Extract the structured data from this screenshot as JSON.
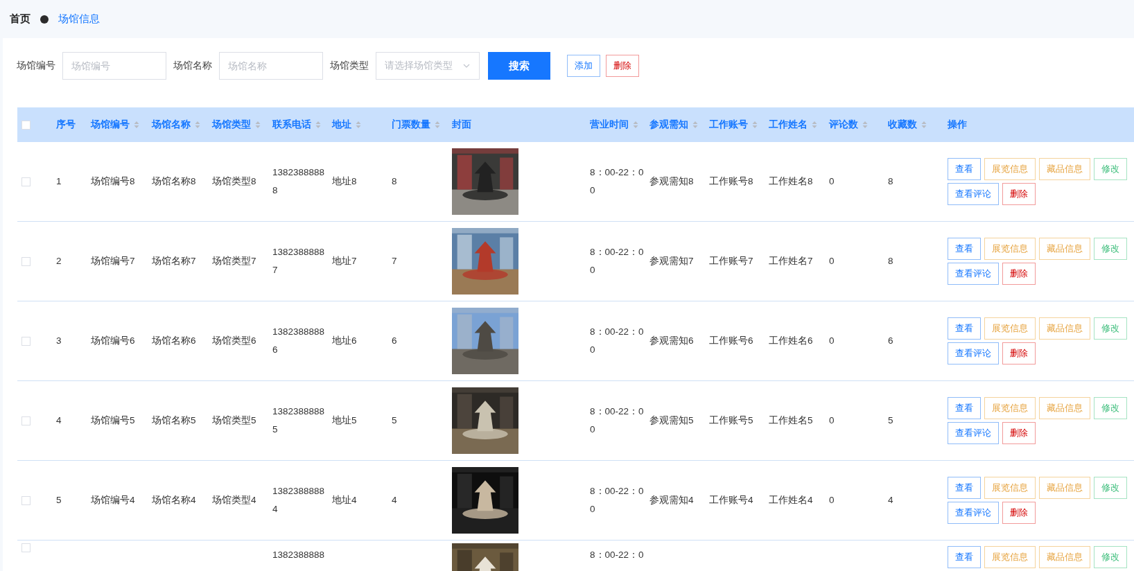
{
  "breadcrumb": {
    "home": "首页",
    "current": "场馆信息"
  },
  "search": {
    "fields": [
      {
        "label": "场馆编号",
        "kind": "input",
        "placeholder": "场馆编号"
      },
      {
        "label": "场馆名称",
        "kind": "input",
        "placeholder": "场馆名称"
      },
      {
        "label": "场馆类型",
        "kind": "select",
        "placeholder": "请选择场馆类型"
      }
    ],
    "search_button": "搜索",
    "add_button": "添加",
    "delete_button": "删除"
  },
  "table": {
    "header_checked": false,
    "columns": [
      {
        "label": "序号",
        "sortable": false
      },
      {
        "label": "场馆编号",
        "sortable": true
      },
      {
        "label": "场馆名称",
        "sortable": true
      },
      {
        "label": "场馆类型",
        "sortable": true
      },
      {
        "label": "联系电话",
        "sortable": true
      },
      {
        "label": "地址",
        "sortable": true
      },
      {
        "label": "门票数量",
        "sortable": true
      },
      {
        "label": "封面",
        "sortable": false
      },
      {
        "label": "营业时间",
        "sortable": true
      },
      {
        "label": "参观需知",
        "sortable": true
      },
      {
        "label": "工作账号",
        "sortable": true
      },
      {
        "label": "工作姓名",
        "sortable": true
      },
      {
        "label": "评论数",
        "sortable": true
      },
      {
        "label": "收藏数",
        "sortable": true
      },
      {
        "label": "操作",
        "sortable": false
      }
    ],
    "rows": [
      {
        "checked": false,
        "index": "1",
        "code": "场馆编号8",
        "name": "场馆名称8",
        "type": "场馆类型8",
        "phone": "13823888888",
        "address": "地址8",
        "tickets": "8",
        "hours": "8：00-22：00",
        "notice": "参观需知8",
        "account": "工作账号8",
        "staff": "工作姓名8",
        "comments": "0",
        "favorites": "8",
        "actions": [
          {
            "label": "查看",
            "kind": "primary"
          },
          {
            "label": "展览信息",
            "kind": "warning"
          },
          {
            "label": "藏品信息",
            "kind": "warning"
          },
          {
            "label": "修改",
            "kind": "success"
          },
          {
            "label": "查看评论",
            "kind": "primary"
          },
          {
            "label": "删除",
            "kind": "danger"
          }
        ]
      },
      {
        "checked": false,
        "index": "2",
        "code": "场馆编号7",
        "name": "场馆名称7",
        "type": "场馆类型7",
        "phone": "13823888887",
        "address": "地址7",
        "tickets": "7",
        "hours": "8：00-22：00",
        "notice": "参观需知7",
        "account": "工作账号7",
        "staff": "工作姓名7",
        "comments": "0",
        "favorites": "8",
        "actions": [
          {
            "label": "查看",
            "kind": "primary"
          },
          {
            "label": "展览信息",
            "kind": "warning"
          },
          {
            "label": "藏品信息",
            "kind": "warning"
          },
          {
            "label": "修改",
            "kind": "success"
          },
          {
            "label": "查看评论",
            "kind": "primary"
          },
          {
            "label": "删除",
            "kind": "danger"
          }
        ]
      },
      {
        "checked": false,
        "index": "3",
        "code": "场馆编号6",
        "name": "场馆名称6",
        "type": "场馆类型6",
        "phone": "13823888886",
        "address": "地址6",
        "tickets": "6",
        "hours": "8：00-22：00",
        "notice": "参观需知6",
        "account": "工作账号6",
        "staff": "工作姓名6",
        "comments": "0",
        "favorites": "6",
        "actions": [
          {
            "label": "查看",
            "kind": "primary"
          },
          {
            "label": "展览信息",
            "kind": "warning"
          },
          {
            "label": "藏品信息",
            "kind": "warning"
          },
          {
            "label": "修改",
            "kind": "success"
          },
          {
            "label": "查看评论",
            "kind": "primary"
          },
          {
            "label": "删除",
            "kind": "danger"
          }
        ]
      },
      {
        "checked": false,
        "index": "4",
        "code": "场馆编号5",
        "name": "场馆名称5",
        "type": "场馆类型5",
        "phone": "13823888885",
        "address": "地址5",
        "tickets": "5",
        "hours": "8：00-22：00",
        "notice": "参观需知5",
        "account": "工作账号5",
        "staff": "工作姓名5",
        "comments": "0",
        "favorites": "5",
        "actions": [
          {
            "label": "查看",
            "kind": "primary"
          },
          {
            "label": "展览信息",
            "kind": "warning"
          },
          {
            "label": "藏品信息",
            "kind": "warning"
          },
          {
            "label": "修改",
            "kind": "success"
          },
          {
            "label": "查看评论",
            "kind": "primary"
          },
          {
            "label": "删除",
            "kind": "danger"
          }
        ]
      },
      {
        "checked": false,
        "index": "5",
        "code": "场馆编号4",
        "name": "场馆名称4",
        "type": "场馆类型4",
        "phone": "13823888884",
        "address": "地址4",
        "tickets": "4",
        "hours": "8：00-22：00",
        "notice": "参观需知4",
        "account": "工作账号4",
        "staff": "工作姓名4",
        "comments": "0",
        "favorites": "4",
        "actions": [
          {
            "label": "查看",
            "kind": "primary"
          },
          {
            "label": "展览信息",
            "kind": "warning"
          },
          {
            "label": "藏品信息",
            "kind": "warning"
          },
          {
            "label": "修改",
            "kind": "success"
          },
          {
            "label": "查看评论",
            "kind": "primary"
          },
          {
            "label": "删除",
            "kind": "danger"
          }
        ]
      },
      {
        "checked": false,
        "phone": "1382388888",
        "hours": "8：00-22：0",
        "actions": [
          {
            "label": "查看",
            "kind": "primary"
          },
          {
            "label": "展览信息",
            "kind": "warning"
          },
          {
            "label": "藏品信息",
            "kind": "warning"
          },
          {
            "label": "修改",
            "kind": "success"
          }
        ]
      }
    ]
  }
}
